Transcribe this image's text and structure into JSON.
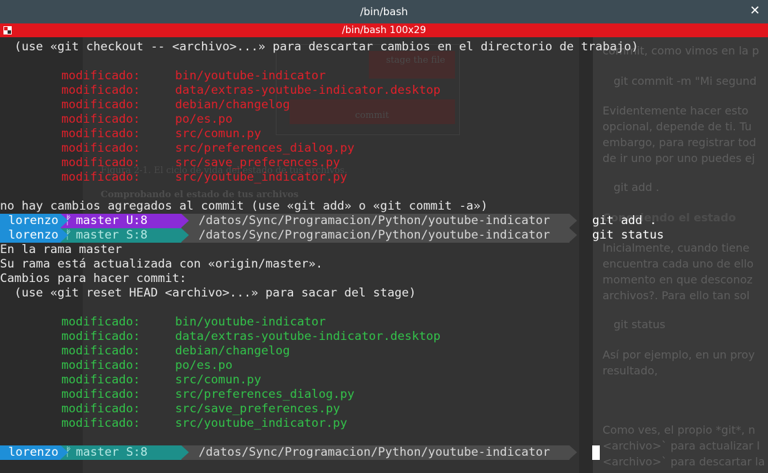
{
  "window": {
    "title": "/bin/bash",
    "tab_title": "/bin/bash 100x29"
  },
  "colors": {
    "titlebar": "#3d4c55",
    "tabbar": "#e0161d",
    "terminal_bg": "#2b2b2b",
    "modified_unstaged": "#e0202a",
    "modified_staged": "#33c24a",
    "prompt_user": "#1e8fd8",
    "prompt_branch_dirty": "#8a2bd6",
    "prompt_branch_staged": "#1d8f8a",
    "prompt_path": "#4c4c4c"
  },
  "background_document": {
    "figure_label_1": "stage the file",
    "figure_label_2": "commit",
    "caption": "Figura 2-1. El ciclo de vida del estado de tus archivos.",
    "heading": "Comprobando el estado de tus archivos",
    "right_lines": [
      "commit, como vimos en la p",
      "git commit -m \"Mi segund",
      "Evidentemente hacer esto",
      "opcional, depende de ti. Tu",
      "embargo, para registrar tod",
      "de ir uno por uno puedes ej",
      "git add .",
      "Conociendo el estado",
      "Inicialmente, cuando tiene",
      "encuentra cada uno de ello",
      "momento en que desconoz",
      "archivos?. Para ello tan sol",
      "git status",
      "Así por ejemplo, en un proy",
      "resultado,",
      "Como ves, el propio *git*, n",
      "<archivo>` para actualizar l",
      "<archivo>` para descartar la"
    ]
  },
  "terminal": {
    "line_checkout_hint": "  (use «git checkout -- <archivo>...» para descartar cambios en el directorio de trabajo)",
    "modified_label": "modificado:",
    "unstaged_files": [
      "bin/youtube-indicator",
      "data/extras-youtube-indicator.desktop",
      "debian/changelog",
      "po/es.po",
      "src/comun.py",
      "src/preferences_dialog.py",
      "src/save_preferences.py",
      "src/youtube_indicator.py"
    ],
    "no_changes_line": "no hay cambios agregados al commit (use «git add» o «git commit -a»)",
    "prompt_user": "lorenzo",
    "prompt_path": "/datos/Sync/Programacion/Python/youtube-indicator",
    "prompt1_branch": "master U:8",
    "prompt1_cmd": "git add .",
    "prompt2_branch": "master S:8",
    "prompt2_cmd": "git status",
    "status_branch": "En la rama master",
    "status_uptodate": "Su rama está actualizada con «origin/master».",
    "status_tocommit": "Cambios para hacer commit:",
    "status_reset_hint": "  (use «git reset HEAD <archivo>...» para sacar del stage)",
    "staged_files": [
      "bin/youtube-indicator",
      "data/extras-youtube-indicator.desktop",
      "debian/changelog",
      "po/es.po",
      "src/comun.py",
      "src/preferences_dialog.py",
      "src/save_preferences.py",
      "src/youtube_indicator.py"
    ],
    "prompt3_branch": "master S:8"
  }
}
